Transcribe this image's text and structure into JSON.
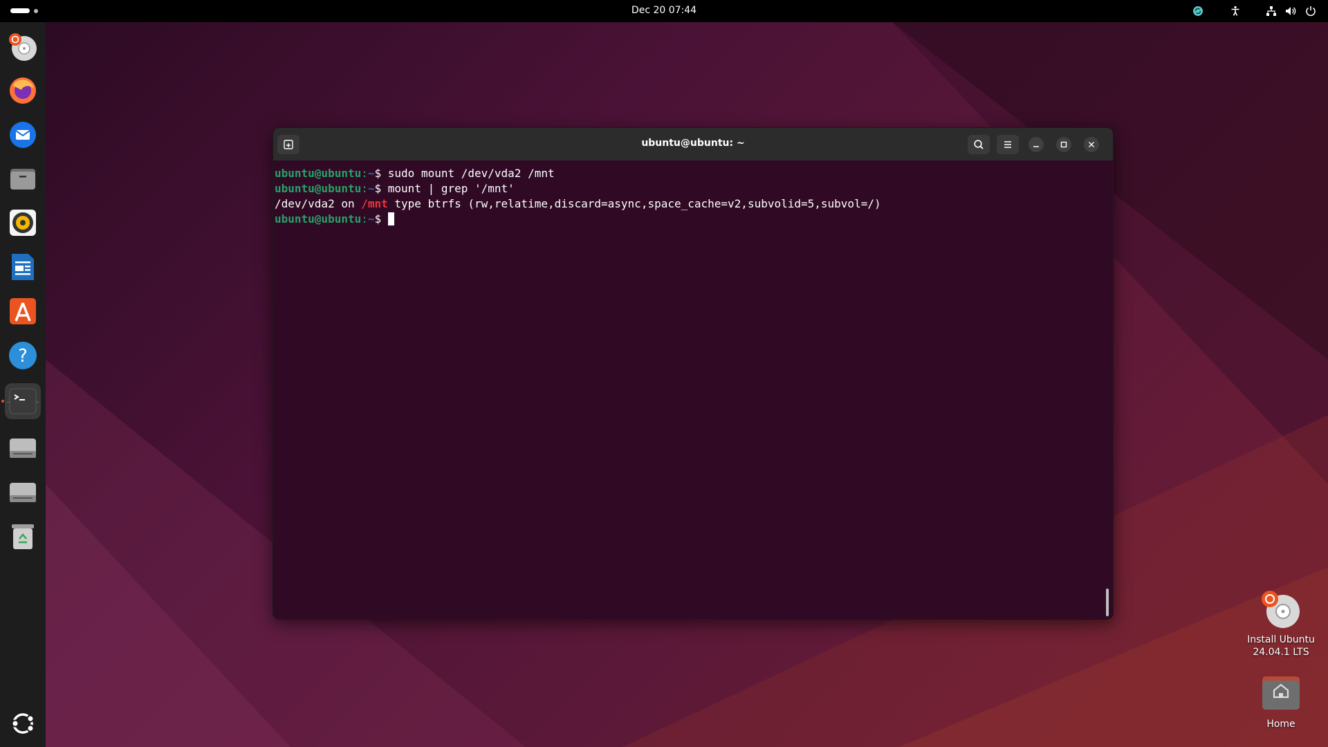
{
  "topbar": {
    "clock": "Dec 20  07:44",
    "tray_icons": [
      "update-icon",
      "accessibility-icon",
      "network-icon",
      "volume-icon",
      "power-icon"
    ]
  },
  "dock": {
    "items": [
      {
        "name": "install-ubuntu",
        "icon": "installer-icon"
      },
      {
        "name": "firefox",
        "icon": "firefox-icon"
      },
      {
        "name": "thunderbird",
        "icon": "thunderbird-icon"
      },
      {
        "name": "files",
        "icon": "files-icon"
      },
      {
        "name": "rhythmbox",
        "icon": "rhythmbox-icon"
      },
      {
        "name": "libreoffice-writer",
        "icon": "writer-icon"
      },
      {
        "name": "app-center",
        "icon": "app-center-icon"
      },
      {
        "name": "help",
        "icon": "help-icon"
      },
      {
        "name": "terminal",
        "icon": "terminal-icon",
        "active": true
      },
      {
        "name": "drive-1",
        "icon": "drive-icon"
      },
      {
        "name": "drive-2",
        "icon": "drive-icon"
      },
      {
        "name": "trash",
        "icon": "trash-icon"
      }
    ],
    "show_apps_icon": "show-apps-icon"
  },
  "terminal": {
    "title": "ubuntu@ubuntu: ~",
    "prompt_user": "ubuntu@ubuntu",
    "prompt_colon": ":",
    "prompt_path": "~",
    "prompt_dollar": "$ ",
    "lines": [
      {
        "type": "cmd",
        "text": "sudo mount /dev/vda2 /mnt"
      },
      {
        "type": "cmd",
        "text": "mount | grep '/mnt'"
      },
      {
        "type": "out",
        "pre": "/dev/vda2 on ",
        "hl": "/mnt",
        "post": " type btrfs (rw,relatime,discard=async,space_cache=v2,subvolid=5,subvol=/)"
      },
      {
        "type": "prompt"
      }
    ]
  },
  "desktop": {
    "install": {
      "line1": "Install Ubuntu",
      "line2": "24.04.1 LTS"
    },
    "home": {
      "label": "Home"
    }
  },
  "colors": {
    "terminal_bg": "#300a24",
    "prompt_green": "#26a269",
    "prompt_blue": "#3465a4",
    "highlight_red": "#ed333b",
    "ubuntu_orange": "#e95420"
  }
}
